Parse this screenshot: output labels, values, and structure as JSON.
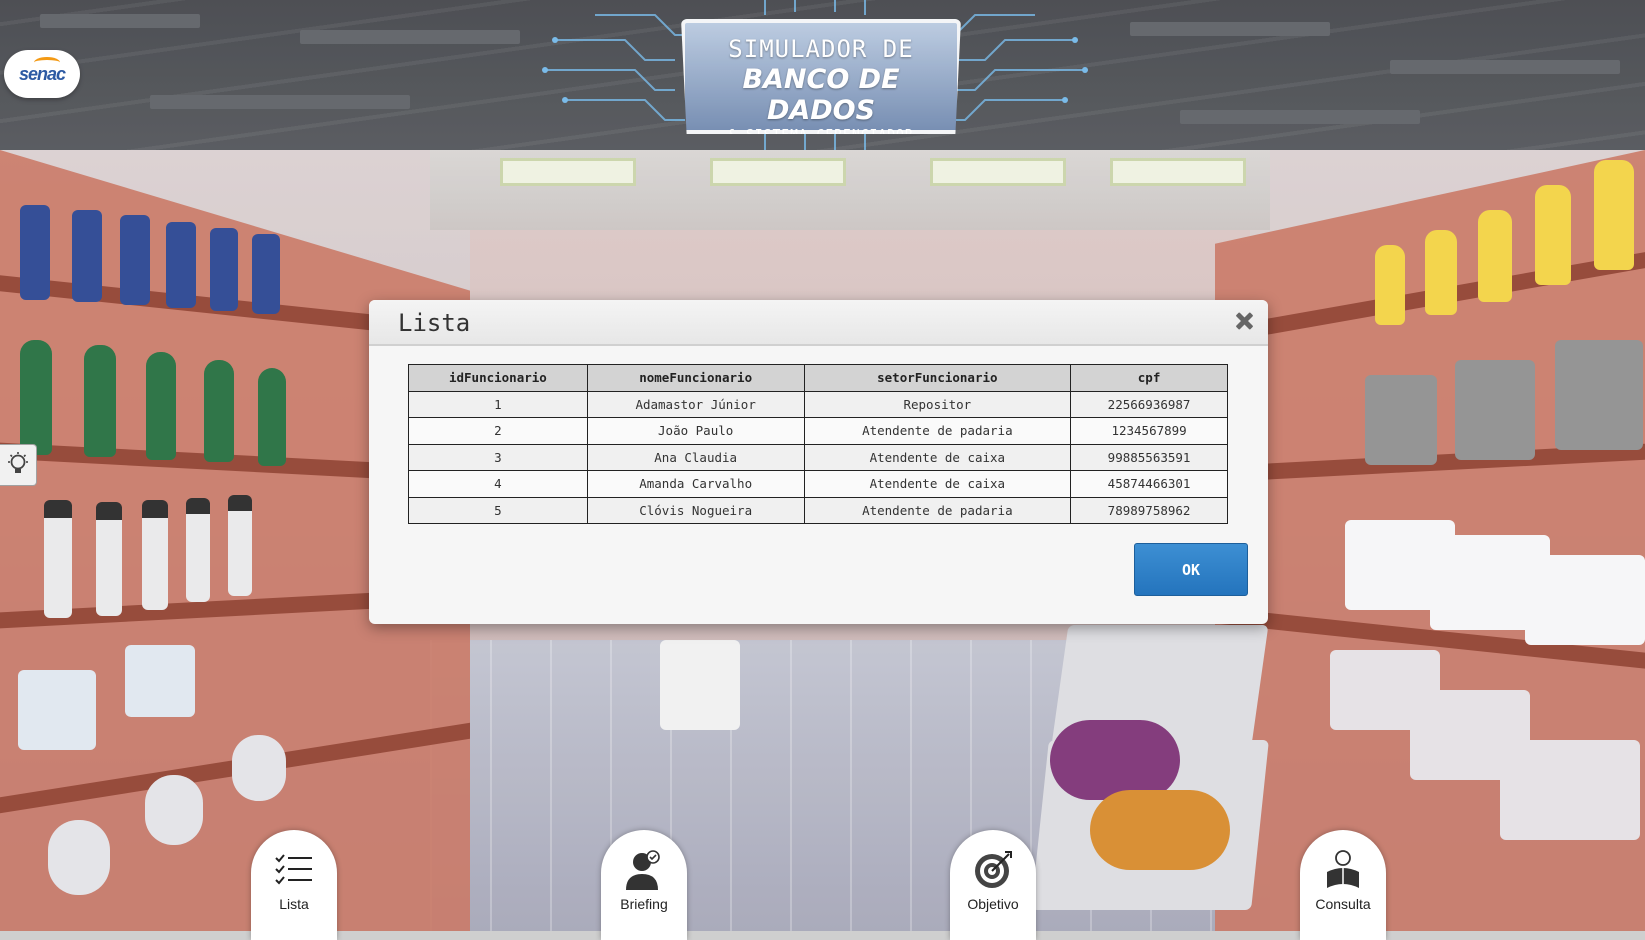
{
  "header": {
    "logo_text": "senac",
    "title_line1": "SIMULADOR DE",
    "title_line2": "BANCO DE DADOS",
    "title_line3": "& SISTEMA GERENCIADOR"
  },
  "modal": {
    "title": "Lista",
    "columns": [
      "idFuncionario",
      "nomeFuncionario",
      "setorFuncionario",
      "cpf"
    ],
    "rows": [
      [
        "1",
        "Adamastor Júnior",
        "Repositor",
        "22566936987"
      ],
      [
        "2",
        "João Paulo",
        "Atendente de padaria",
        "1234567899"
      ],
      [
        "3",
        "Ana Claudia",
        "Atendente de caixa",
        "99885563591"
      ],
      [
        "4",
        "Amanda Carvalho",
        "Atendente de caixa",
        "45874466301"
      ],
      [
        "5",
        "Clóvis Nogueira",
        "Atendente de padaria",
        "78989758962"
      ]
    ],
    "ok_label": "OK"
  },
  "nav": {
    "items": [
      {
        "label": "Lista",
        "icon": "checklist-icon"
      },
      {
        "label": "Briefing",
        "icon": "person-check-icon"
      },
      {
        "label": "Objetivo",
        "icon": "target-icon"
      },
      {
        "label": "Consulta",
        "icon": "reader-icon"
      }
    ]
  },
  "colors": {
    "accent": "#2f82c8",
    "shelf": "#c7705c",
    "header_bg": "#45484d"
  }
}
